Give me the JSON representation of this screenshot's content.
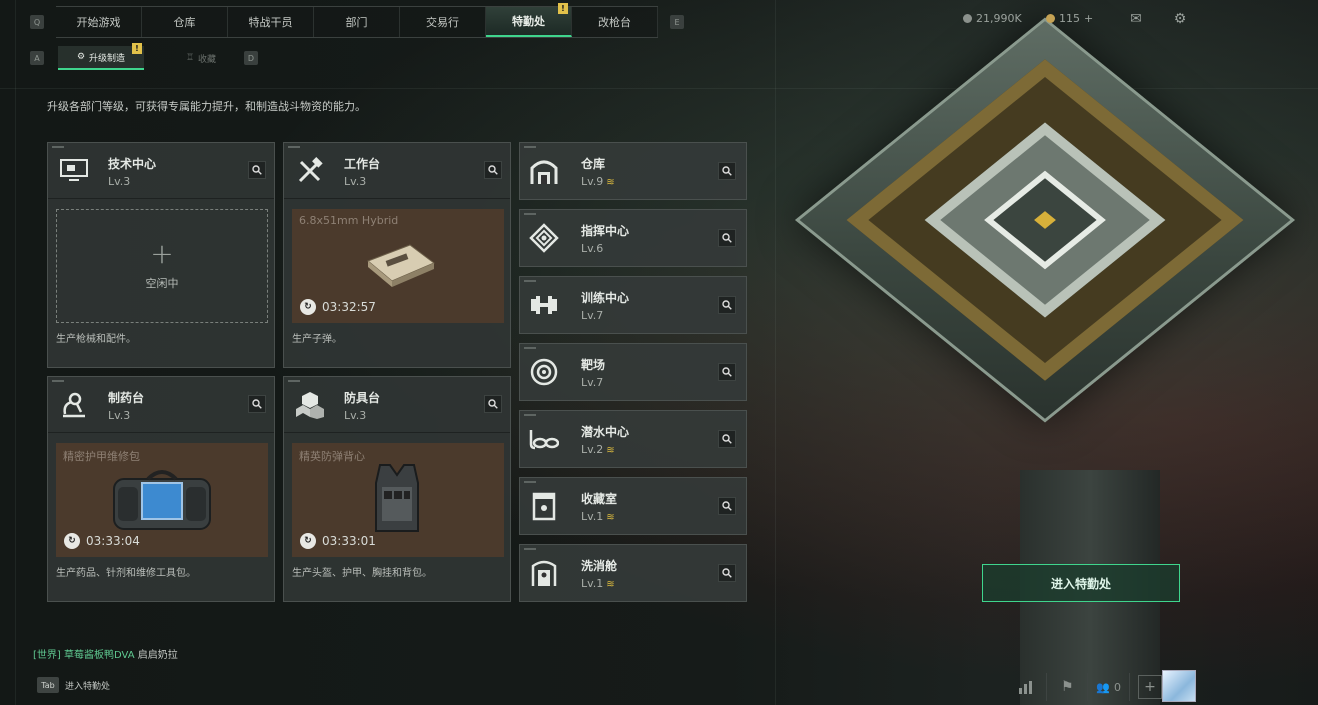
{
  "nav": {
    "left_key": "Q",
    "right_key": "E",
    "tabs": [
      {
        "label": "开始游戏"
      },
      {
        "label": "仓库"
      },
      {
        "label": "特战干员"
      },
      {
        "label": "部门"
      },
      {
        "label": "交易行"
      },
      {
        "label": "特勤处",
        "active": true,
        "badge": "!"
      },
      {
        "label": "改枪台"
      }
    ]
  },
  "resources": {
    "coins": "21,990K",
    "premium": "115",
    "premium_plus": "+"
  },
  "subnav": {
    "left_key": "A",
    "right_key": "D",
    "tabs": [
      {
        "label": "升级制造",
        "active": true,
        "badge": "!"
      },
      {
        "label": "收藏"
      }
    ]
  },
  "description": "升级各部门等级，可获得专属能力提升，和制造战斗物资的能力。",
  "workstations": [
    {
      "name": "技术中心",
      "level": "Lv.3",
      "icon": "monitor-icon",
      "slot": {
        "state": "idle",
        "idle_label": "空闲中",
        "plus": "+"
      },
      "footer": "生产枪械和配件。"
    },
    {
      "name": "工作台",
      "level": "Lv.3",
      "icon": "tools-icon",
      "slot": {
        "state": "busy",
        "item": "6.8x51mm Hybrid",
        "timer": "03:32:57",
        "item_icon": "ammo-box-icon"
      },
      "footer": "生产子弹。"
    },
    {
      "name": "制药台",
      "level": "Lv.3",
      "icon": "microscope-icon",
      "slot": {
        "state": "busy",
        "item": "精密护甲维修包",
        "timer": "03:33:04",
        "item_icon": "repair-kit-icon"
      },
      "footer": "生产药品、针剂和维修工具包。"
    },
    {
      "name": "防具台",
      "level": "Lv.3",
      "icon": "cubes-icon",
      "slot": {
        "state": "busy",
        "item": "精英防弹背心",
        "timer": "03:33:01",
        "item_icon": "vest-icon"
      },
      "footer": "生产头盔、护甲、胸挂和背包。"
    }
  ],
  "facilities": [
    {
      "name": "仓库",
      "level": "Lv.9",
      "upgradable": true,
      "icon": "warehouse-icon"
    },
    {
      "name": "指挥中心",
      "level": "Lv.6",
      "upgradable": false,
      "icon": "command-icon"
    },
    {
      "name": "训练中心",
      "level": "Lv.7",
      "upgradable": false,
      "icon": "dumbbell-icon"
    },
    {
      "name": "靶场",
      "level": "Lv.7",
      "upgradable": false,
      "icon": "target-icon"
    },
    {
      "name": "潜水中心",
      "level": "Lv.2",
      "upgradable": true,
      "icon": "diving-goggles-icon"
    },
    {
      "name": "收藏室",
      "level": "Lv.1",
      "upgradable": true,
      "icon": "collection-icon"
    },
    {
      "name": "洗消舱",
      "level": "Lv.1",
      "upgradable": true,
      "icon": "decon-icon"
    }
  ],
  "upgrade_mark": "≋",
  "enter_button": "进入特勤处",
  "chat": {
    "channel": "[世界]",
    "sender": "草莓酱板鸭DVA",
    "message": "启启奶拉"
  },
  "tab_hint": {
    "key": "Tab",
    "label": "进入特勤处"
  },
  "bottom": {
    "friends_count": "0"
  },
  "colors": {
    "accent": "#3fd58d",
    "badge": "#e2c14a",
    "upgrade": "#e0be3f"
  }
}
